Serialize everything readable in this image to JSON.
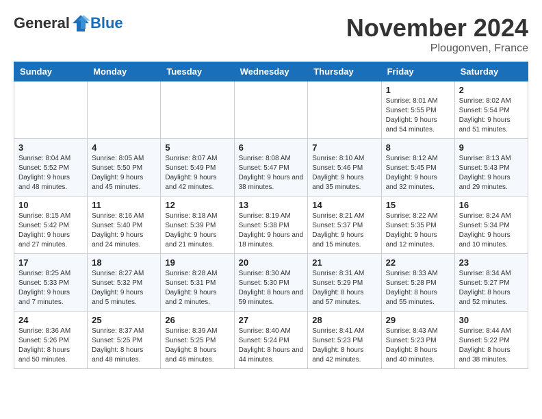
{
  "logo": {
    "general": "General",
    "blue": "Blue"
  },
  "title": "November 2024",
  "location": "Plougonven, France",
  "days_of_week": [
    "Sunday",
    "Monday",
    "Tuesday",
    "Wednesday",
    "Thursday",
    "Friday",
    "Saturday"
  ],
  "weeks": [
    [
      {
        "day": "",
        "info": ""
      },
      {
        "day": "",
        "info": ""
      },
      {
        "day": "",
        "info": ""
      },
      {
        "day": "",
        "info": ""
      },
      {
        "day": "",
        "info": ""
      },
      {
        "day": "1",
        "info": "Sunrise: 8:01 AM\nSunset: 5:55 PM\nDaylight: 9 hours and 54 minutes."
      },
      {
        "day": "2",
        "info": "Sunrise: 8:02 AM\nSunset: 5:54 PM\nDaylight: 9 hours and 51 minutes."
      }
    ],
    [
      {
        "day": "3",
        "info": "Sunrise: 8:04 AM\nSunset: 5:52 PM\nDaylight: 9 hours and 48 minutes."
      },
      {
        "day": "4",
        "info": "Sunrise: 8:05 AM\nSunset: 5:50 PM\nDaylight: 9 hours and 45 minutes."
      },
      {
        "day": "5",
        "info": "Sunrise: 8:07 AM\nSunset: 5:49 PM\nDaylight: 9 hours and 42 minutes."
      },
      {
        "day": "6",
        "info": "Sunrise: 8:08 AM\nSunset: 5:47 PM\nDaylight: 9 hours and 38 minutes."
      },
      {
        "day": "7",
        "info": "Sunrise: 8:10 AM\nSunset: 5:46 PM\nDaylight: 9 hours and 35 minutes."
      },
      {
        "day": "8",
        "info": "Sunrise: 8:12 AM\nSunset: 5:45 PM\nDaylight: 9 hours and 32 minutes."
      },
      {
        "day": "9",
        "info": "Sunrise: 8:13 AM\nSunset: 5:43 PM\nDaylight: 9 hours and 29 minutes."
      }
    ],
    [
      {
        "day": "10",
        "info": "Sunrise: 8:15 AM\nSunset: 5:42 PM\nDaylight: 9 hours and 27 minutes."
      },
      {
        "day": "11",
        "info": "Sunrise: 8:16 AM\nSunset: 5:40 PM\nDaylight: 9 hours and 24 minutes."
      },
      {
        "day": "12",
        "info": "Sunrise: 8:18 AM\nSunset: 5:39 PM\nDaylight: 9 hours and 21 minutes."
      },
      {
        "day": "13",
        "info": "Sunrise: 8:19 AM\nSunset: 5:38 PM\nDaylight: 9 hours and 18 minutes."
      },
      {
        "day": "14",
        "info": "Sunrise: 8:21 AM\nSunset: 5:37 PM\nDaylight: 9 hours and 15 minutes."
      },
      {
        "day": "15",
        "info": "Sunrise: 8:22 AM\nSunset: 5:35 PM\nDaylight: 9 hours and 12 minutes."
      },
      {
        "day": "16",
        "info": "Sunrise: 8:24 AM\nSunset: 5:34 PM\nDaylight: 9 hours and 10 minutes."
      }
    ],
    [
      {
        "day": "17",
        "info": "Sunrise: 8:25 AM\nSunset: 5:33 PM\nDaylight: 9 hours and 7 minutes."
      },
      {
        "day": "18",
        "info": "Sunrise: 8:27 AM\nSunset: 5:32 PM\nDaylight: 9 hours and 5 minutes."
      },
      {
        "day": "19",
        "info": "Sunrise: 8:28 AM\nSunset: 5:31 PM\nDaylight: 9 hours and 2 minutes."
      },
      {
        "day": "20",
        "info": "Sunrise: 8:30 AM\nSunset: 5:30 PM\nDaylight: 8 hours and 59 minutes."
      },
      {
        "day": "21",
        "info": "Sunrise: 8:31 AM\nSunset: 5:29 PM\nDaylight: 8 hours and 57 minutes."
      },
      {
        "day": "22",
        "info": "Sunrise: 8:33 AM\nSunset: 5:28 PM\nDaylight: 8 hours and 55 minutes."
      },
      {
        "day": "23",
        "info": "Sunrise: 8:34 AM\nSunset: 5:27 PM\nDaylight: 8 hours and 52 minutes."
      }
    ],
    [
      {
        "day": "24",
        "info": "Sunrise: 8:36 AM\nSunset: 5:26 PM\nDaylight: 8 hours and 50 minutes."
      },
      {
        "day": "25",
        "info": "Sunrise: 8:37 AM\nSunset: 5:25 PM\nDaylight: 8 hours and 48 minutes."
      },
      {
        "day": "26",
        "info": "Sunrise: 8:39 AM\nSunset: 5:25 PM\nDaylight: 8 hours and 46 minutes."
      },
      {
        "day": "27",
        "info": "Sunrise: 8:40 AM\nSunset: 5:24 PM\nDaylight: 8 hours and 44 minutes."
      },
      {
        "day": "28",
        "info": "Sunrise: 8:41 AM\nSunset: 5:23 PM\nDaylight: 8 hours and 42 minutes."
      },
      {
        "day": "29",
        "info": "Sunrise: 8:43 AM\nSunset: 5:23 PM\nDaylight: 8 hours and 40 minutes."
      },
      {
        "day": "30",
        "info": "Sunrise: 8:44 AM\nSunset: 5:22 PM\nDaylight: 8 hours and 38 minutes."
      }
    ]
  ]
}
